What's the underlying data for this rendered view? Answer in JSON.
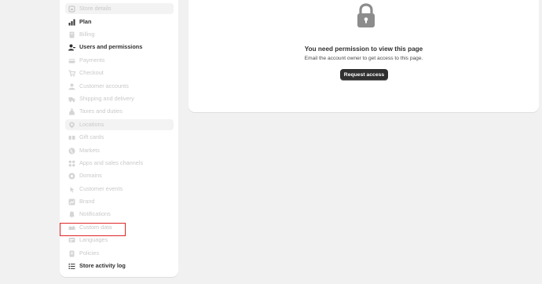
{
  "sidebar": {
    "items": [
      {
        "label": "Store details",
        "icon": "store-icon",
        "enabled": false
      },
      {
        "label": "Plan",
        "icon": "plan-icon",
        "enabled": true
      },
      {
        "label": "Billing",
        "icon": "billing-icon",
        "enabled": false
      },
      {
        "label": "Users and permissions",
        "icon": "users-icon",
        "enabled": true
      },
      {
        "label": "Payments",
        "icon": "payments-icon",
        "enabled": false
      },
      {
        "label": "Checkout",
        "icon": "cart-icon",
        "enabled": false
      },
      {
        "label": "Customer accounts",
        "icon": "person-icon",
        "enabled": false
      },
      {
        "label": "Shipping and delivery",
        "icon": "truck-icon",
        "enabled": false
      },
      {
        "label": "Taxes and duties",
        "icon": "tax-icon",
        "enabled": false
      },
      {
        "label": "Locations",
        "icon": "location-icon",
        "enabled": false
      },
      {
        "label": "Gift cards",
        "icon": "gift-card-icon",
        "enabled": false
      },
      {
        "label": "Markets",
        "icon": "globe-icon",
        "enabled": false
      },
      {
        "label": "Apps and sales channels",
        "icon": "apps-icon",
        "enabled": false
      },
      {
        "label": "Domains",
        "icon": "domain-icon",
        "enabled": false
      },
      {
        "label": "Customer events",
        "icon": "cursor-icon",
        "enabled": false
      },
      {
        "label": "Brand",
        "icon": "brand-icon",
        "enabled": false
      },
      {
        "label": "Notifications",
        "icon": "bell-icon",
        "enabled": false
      },
      {
        "label": "Custom data",
        "icon": "custom-data-icon",
        "enabled": false
      },
      {
        "label": "Languages",
        "icon": "language-icon",
        "enabled": false
      },
      {
        "label": "Policies",
        "icon": "policy-icon",
        "enabled": false
      },
      {
        "label": "Store activity log",
        "icon": "list-icon",
        "enabled": true
      }
    ]
  },
  "main": {
    "icon": "lock-icon",
    "title": "You need permission to view this page",
    "subtitle": "Email the account owner to get access to this page.",
    "button_label": "Request access"
  },
  "colors": {
    "enabled_text": "#303030",
    "disabled_text": "#c9c9c9",
    "highlight": "#e02424",
    "button_bg": "#303030"
  }
}
